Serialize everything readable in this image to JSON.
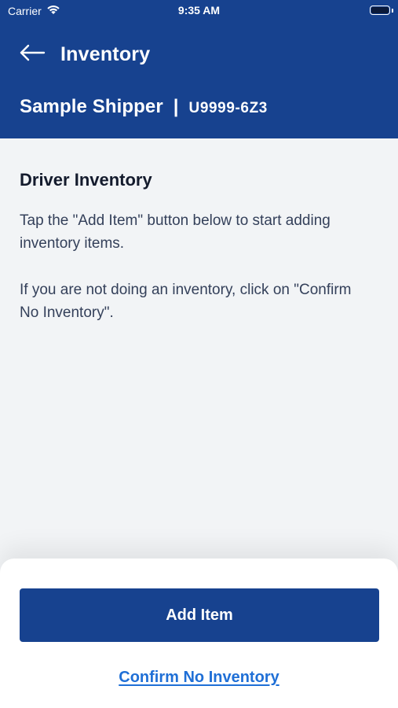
{
  "status_bar": {
    "carrier": "Carrier",
    "time": "9:35 AM"
  },
  "header": {
    "title": "Inventory",
    "shipper_name": "Sample Shipper",
    "divider": "|",
    "shipper_code": "U9999-6Z3"
  },
  "content": {
    "section_title": "Driver Inventory",
    "instructions": [
      "Tap the \"Add Item\" button below to start adding inventory items.",
      "If you are not doing an inventory, click on \"Confirm No Inventory\"."
    ]
  },
  "actions": {
    "add_item_label": "Add Item",
    "confirm_no_inventory_label": "Confirm No Inventory"
  },
  "icons": {
    "back": "arrow-left-icon",
    "wifi": "wifi-icon",
    "battery": "battery-icon"
  },
  "colors": {
    "brand": "#17428f",
    "background": "#f2f4f6",
    "link": "#1f6fd6",
    "sheet": "#ffffff"
  }
}
